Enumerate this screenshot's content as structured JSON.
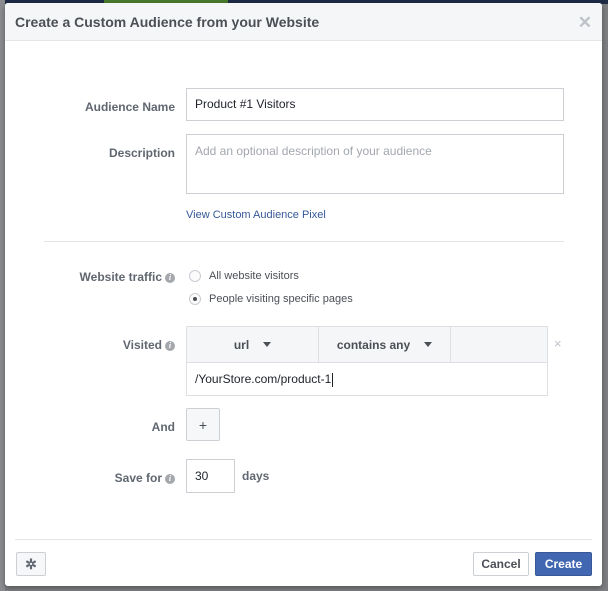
{
  "dialog": {
    "title": "Create a Custom Audience from your Website",
    "close_icon": "close-icon"
  },
  "form": {
    "audience_name": {
      "label": "Audience Name",
      "value": "Product #1 Visitors"
    },
    "description": {
      "label": "Description",
      "value": "",
      "placeholder": "Add an optional description of your audience"
    },
    "pixel_link": "View Custom Audience Pixel",
    "website_traffic": {
      "label": "Website traffic",
      "info_icon": "i",
      "options": [
        {
          "label": "All website visitors",
          "checked": false
        },
        {
          "label": "People visiting specific pages",
          "checked": true
        }
      ]
    },
    "visited": {
      "label": "Visited",
      "info_icon": "i",
      "field_select": "url",
      "operator_select": "contains any",
      "value": "/YourStore.com/product-1",
      "remove_icon": "×"
    },
    "and": {
      "label": "And",
      "add_button": "+"
    },
    "save_for": {
      "label": "Save for",
      "info_icon": "i",
      "value": "30",
      "unit": "days"
    }
  },
  "footer": {
    "settings_icon": "✲",
    "cancel_label": "Cancel",
    "create_label": "Create"
  }
}
